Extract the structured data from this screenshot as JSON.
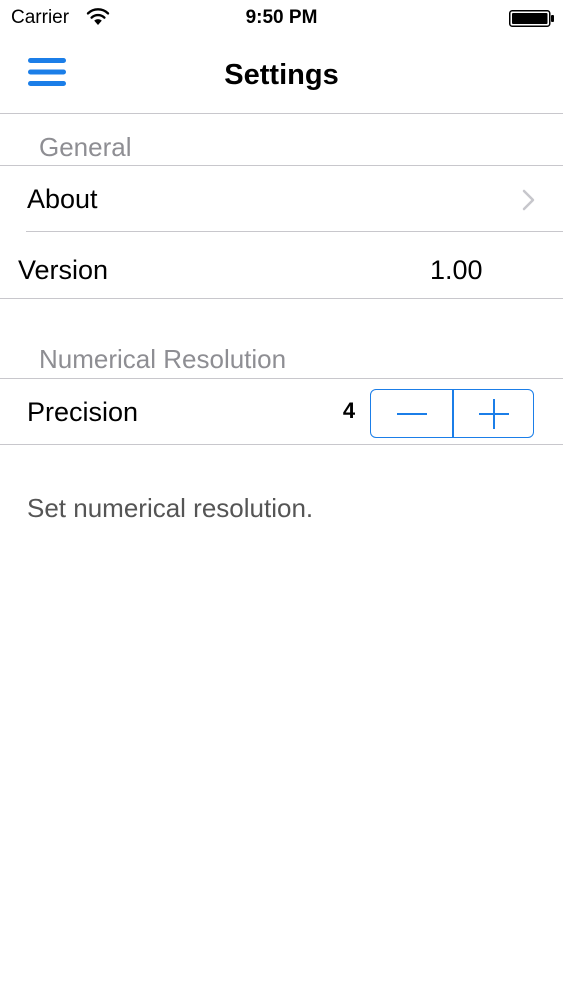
{
  "status_bar": {
    "carrier": "Carrier",
    "time": "9:50 PM",
    "wifi_icon": "wifi-icon",
    "battery_icon": "battery-icon"
  },
  "nav_bar": {
    "title": "Settings",
    "menu_icon": "hamburger-menu-icon"
  },
  "sections": {
    "general": {
      "header": "General",
      "about_label": "About",
      "version_label": "Version",
      "version_value": "1.00"
    },
    "numerical_resolution": {
      "header": "Numerical Resolution",
      "precision_label": "Precision",
      "precision_value": "4",
      "footer": "Set numerical resolution."
    }
  },
  "colors": {
    "accent": "#1b7ee8",
    "section_header": "#8e8e93",
    "separator": "#c8c7cc",
    "chevron": "#c7c7cc"
  }
}
